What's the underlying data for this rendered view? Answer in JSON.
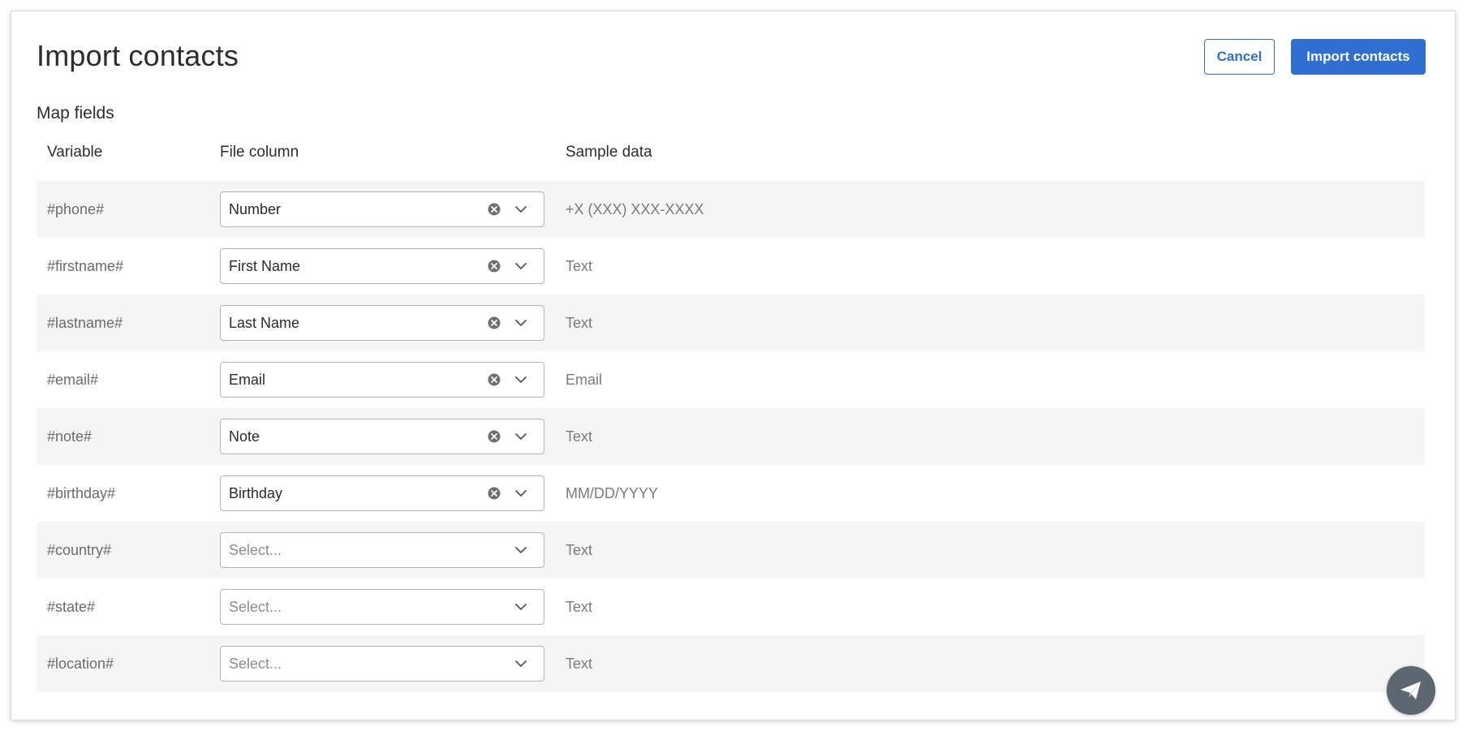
{
  "header": {
    "title": "Import contacts",
    "cancel_label": "Cancel",
    "import_label": "Import contacts"
  },
  "section": {
    "title": "Map fields"
  },
  "columns": {
    "variable": "Variable",
    "file_column": "File column",
    "sample_data": "Sample data"
  },
  "rows": [
    {
      "variable": "#phone#",
      "file_column": "Number",
      "placeholder": false,
      "sample": "+X (XXX) XXX-XXXX"
    },
    {
      "variable": "#firstname#",
      "file_column": "First Name",
      "placeholder": false,
      "sample": "Text"
    },
    {
      "variable": "#lastname#",
      "file_column": "Last Name",
      "placeholder": false,
      "sample": "Text"
    },
    {
      "variable": "#email#",
      "file_column": "Email",
      "placeholder": false,
      "sample": "Email"
    },
    {
      "variable": "#note#",
      "file_column": "Note",
      "placeholder": false,
      "sample": "Text"
    },
    {
      "variable": "#birthday#",
      "file_column": "Birthday",
      "placeholder": false,
      "sample": "MM/DD/YYYY"
    },
    {
      "variable": "#country#",
      "file_column": "Select...",
      "placeholder": true,
      "sample": "Text"
    },
    {
      "variable": "#state#",
      "file_column": "Select...",
      "placeholder": true,
      "sample": "Text"
    },
    {
      "variable": "#location#",
      "file_column": "Select...",
      "placeholder": true,
      "sample": "Text"
    }
  ],
  "icons": {
    "clear": "clear-circle-icon",
    "chevron": "chevron-down-icon",
    "fab": "paper-plane-icon"
  },
  "colors": {
    "primary": "#2f6fd1",
    "row_shade": "#f5f5f5",
    "fab": "#5c6670"
  }
}
